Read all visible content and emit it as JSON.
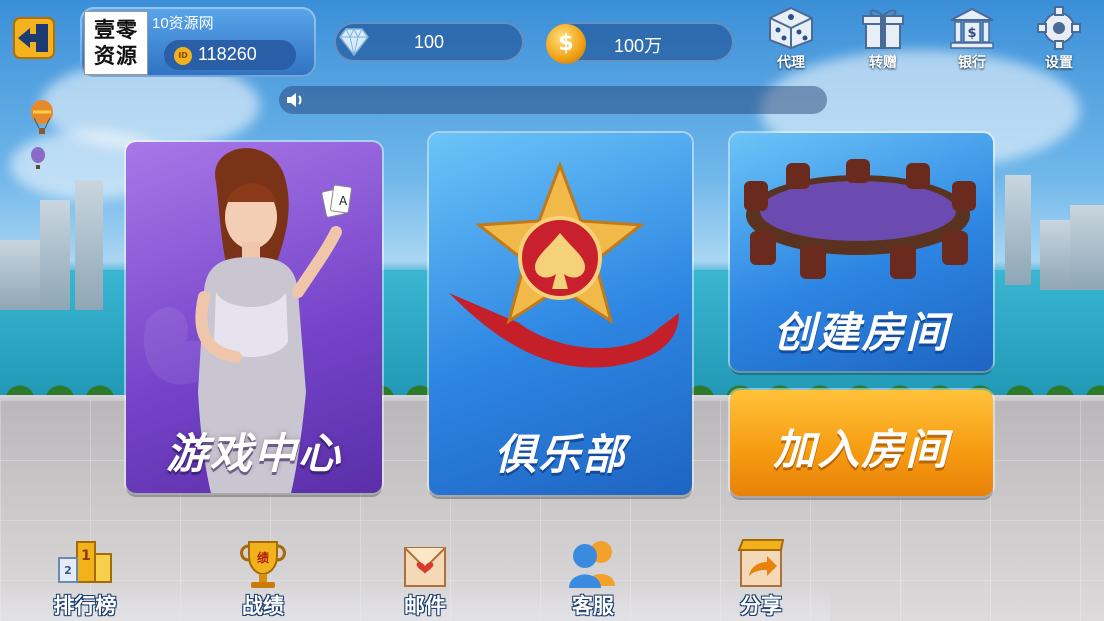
{
  "header": {
    "logo_line1": "壹零",
    "logo_line2": "资源",
    "nickname": "10资源网",
    "id_badge": "ID",
    "user_id": "118260",
    "diamonds": "100",
    "coins": "100万",
    "coin_symbol": "$"
  },
  "top_menu": [
    {
      "label": "代理",
      "icon": "dice-icon"
    },
    {
      "label": "转赠",
      "icon": "gift-icon"
    },
    {
      "label": "银行",
      "icon": "bank-icon"
    },
    {
      "label": "设置",
      "icon": "gear-icon"
    }
  ],
  "cards": {
    "game_center": "游戏中心",
    "club": "俱乐部",
    "create_room": "创建房间",
    "join_room": "加入房间"
  },
  "bottom_menu": [
    {
      "label": "排行榜",
      "icon": "ranking-icon"
    },
    {
      "label": "战绩",
      "icon": "trophy-icon"
    },
    {
      "label": "邮件",
      "icon": "mail-icon"
    },
    {
      "label": "客服",
      "icon": "customer-service-icon"
    },
    {
      "label": "分享",
      "icon": "share-icon"
    }
  ],
  "colors": {
    "sky": "#3b8fd8",
    "purple_card": "#7442c8",
    "blue_card": "#2d86e2",
    "orange_card": "#f59a10",
    "gold": "#f1b21c"
  }
}
